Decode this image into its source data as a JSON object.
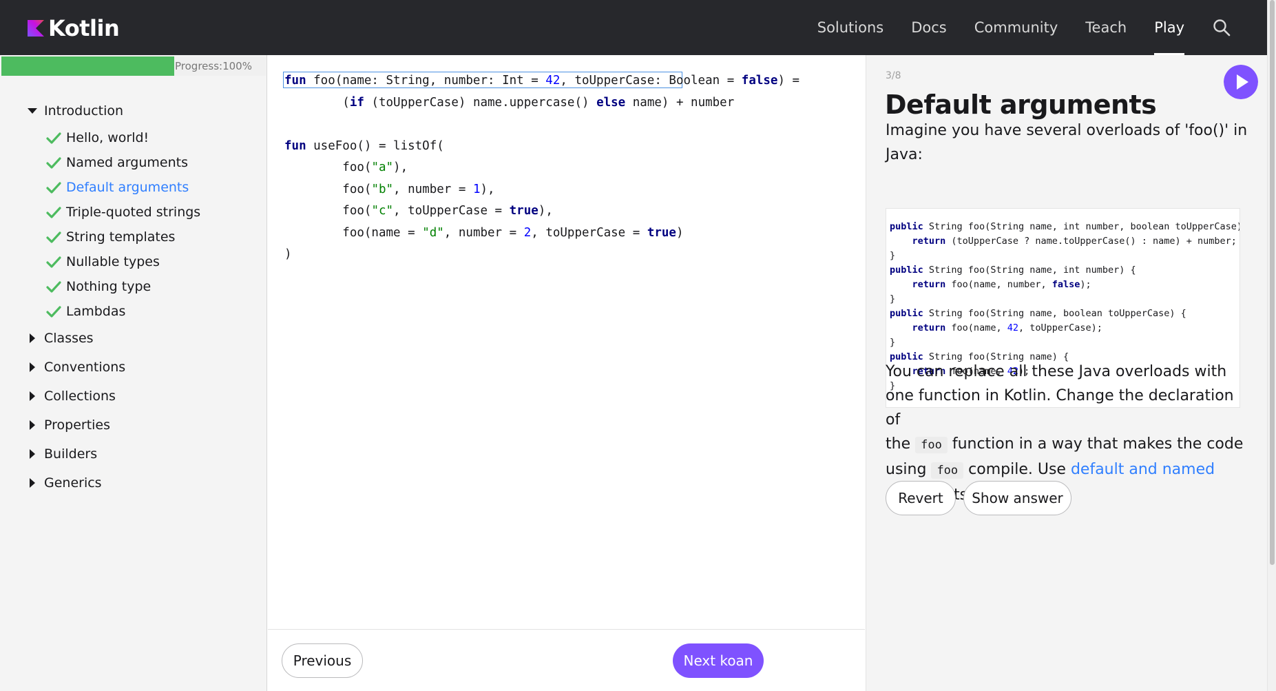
{
  "header": {
    "brand": "Kotlin",
    "nav": [
      "Solutions",
      "Docs",
      "Community",
      "Teach",
      "Play"
    ],
    "active_nav": "Play"
  },
  "sidebar": {
    "progress": {
      "label": "Progress:100%",
      "value": 100
    },
    "sections": [
      {
        "label": "Introduction",
        "expanded": true,
        "items": [
          {
            "label": "Hello, world!",
            "completed": true
          },
          {
            "label": "Named arguments",
            "completed": true
          },
          {
            "label": "Default arguments",
            "completed": true,
            "current": true
          },
          {
            "label": "Triple-quoted strings",
            "completed": true
          },
          {
            "label": "String templates",
            "completed": true
          },
          {
            "label": "Nullable types",
            "completed": true
          },
          {
            "label": "Nothing type",
            "completed": true
          },
          {
            "label": "Lambdas",
            "completed": true
          }
        ]
      },
      {
        "label": "Classes",
        "expanded": false
      },
      {
        "label": "Conventions",
        "expanded": false
      },
      {
        "label": "Collections",
        "expanded": false
      },
      {
        "label": "Properties",
        "expanded": false
      },
      {
        "label": "Builders",
        "expanded": false
      },
      {
        "label": "Generics",
        "expanded": false
      }
    ]
  },
  "editor": {
    "code_lines": [
      "fun foo(name: String, number: Int = 42, toUpperCase: Boolean = false) =",
      "        (if (toUpperCase) name.uppercase() else name) + number",
      "",
      "fun useFoo() = listOf(",
      "        foo(\"a\"),",
      "        foo(\"b\", number = 1),",
      "        foo(\"c\", toUpperCase = true),",
      "        foo(name = \"d\", number = 2, toUpperCase = true)",
      ")"
    ],
    "previous_label": "Previous",
    "next_label": "Next koan"
  },
  "task": {
    "step": "3/8",
    "title": "Default arguments",
    "intro_line1": "Imagine you have several overloads of 'foo()' in",
    "intro_line2": "Java:",
    "java_code_lines": [
      "public String foo(String name, int number, boolean toUpperCase) {",
      "    return (toUpperCase ? name.toUpperCase() : name) + number;",
      "}",
      "public String foo(String name, int number) {",
      "    return foo(name, number, false);",
      "}",
      "public String foo(String name, boolean toUpperCase) {",
      "    return foo(name, 42, toUpperCase);",
      "}",
      "public String foo(String name) {",
      "    return foo(name, 42);",
      "}"
    ],
    "body": {
      "line1": "You can replace all these Java overloads with",
      "line2": "one function in Kotlin. Change the declaration of",
      "line3_before": "the",
      "code1": "foo",
      "line3_after": "function in a way that makes the code",
      "line4_before": "using",
      "code2": "foo",
      "line4_mid": "compile. Use",
      "link": "default and named",
      "line5": "arguments."
    },
    "revert_label": "Revert",
    "show_answer_label": "Show answer"
  },
  "colors": {
    "header_bg": "#27282c",
    "accent": "#7f52ff",
    "progress": "#4dbb5f",
    "link": "#307fff"
  }
}
